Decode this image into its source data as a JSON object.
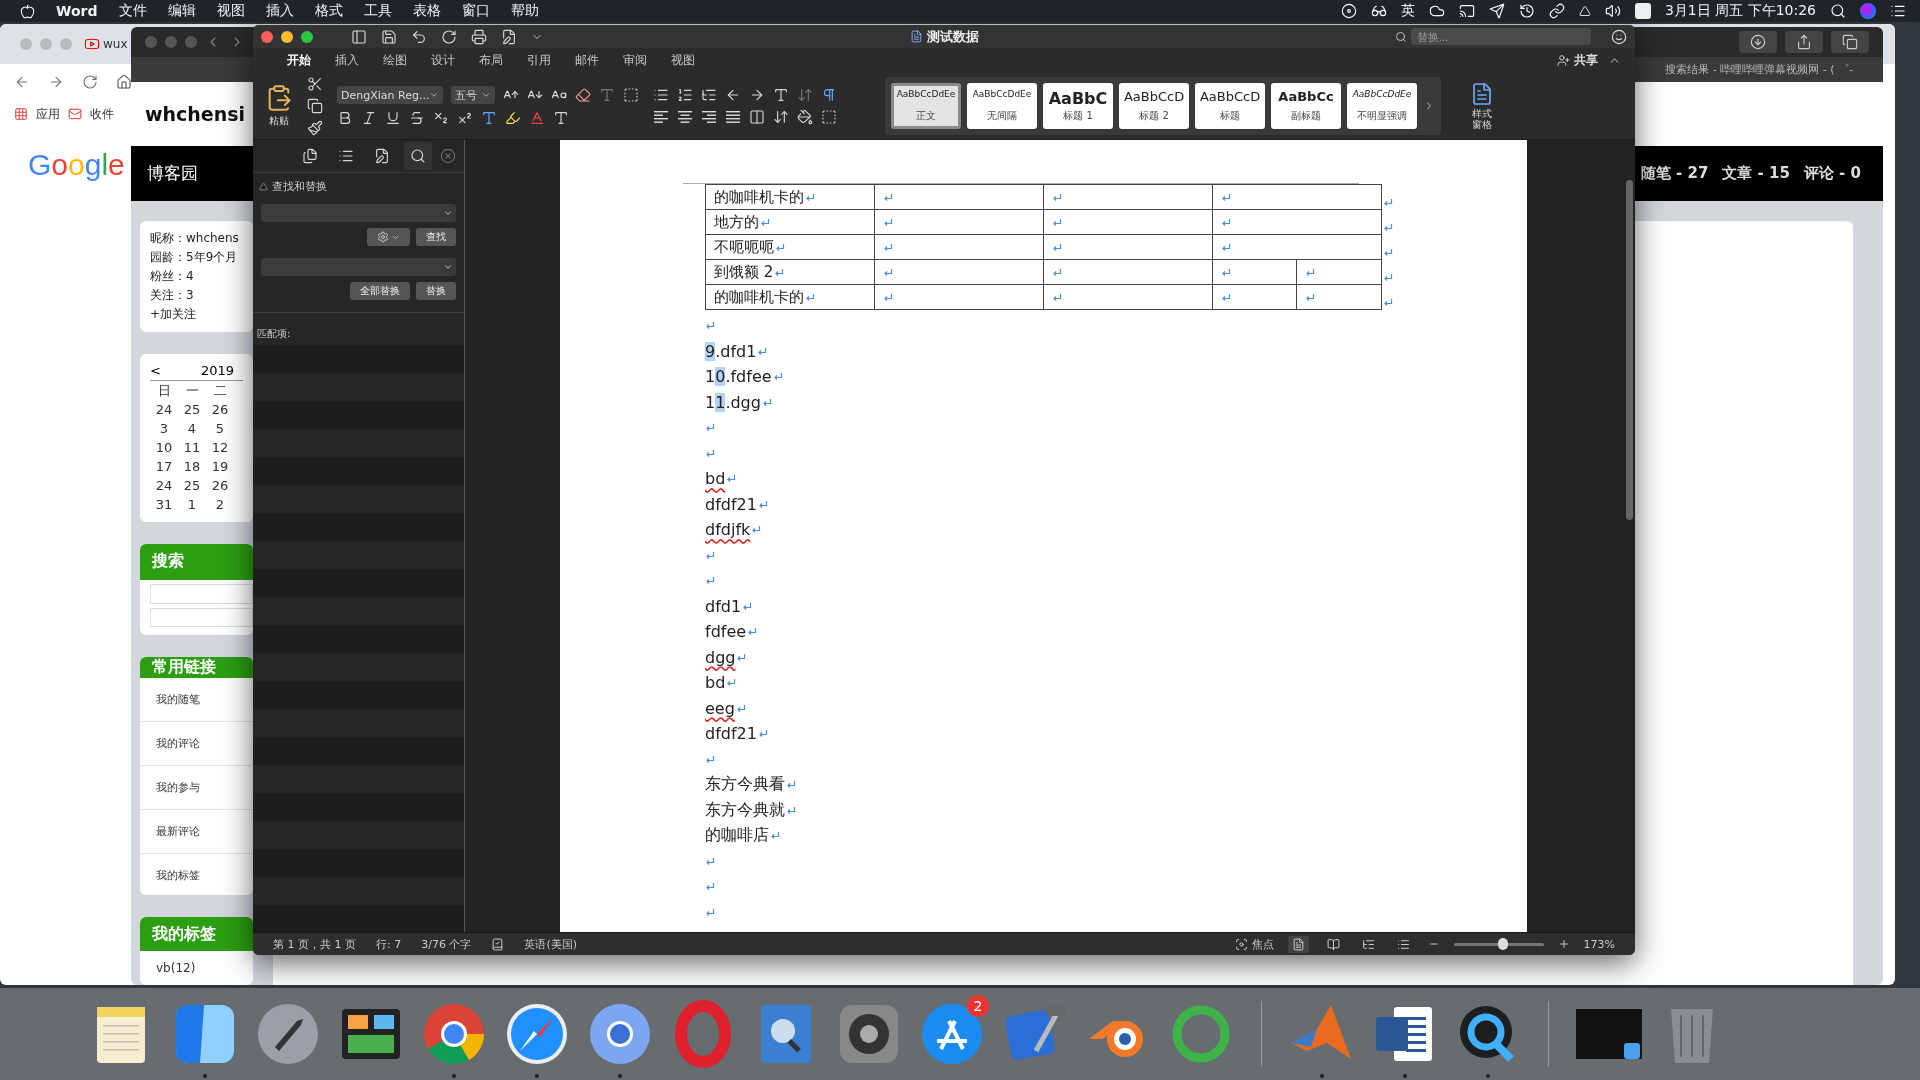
{
  "menubar": {
    "app": "Word",
    "menus": [
      "文件",
      "编辑",
      "视图",
      "插入",
      "格式",
      "工具",
      "表格",
      "窗口",
      "帮助"
    ],
    "input_source": "英",
    "clock": "3月1日 周五 下午10:26"
  },
  "chrome_window": {
    "tab_title": "wux",
    "bookmarks": [
      "应用",
      "收件"
    ],
    "logo": "Google"
  },
  "blog_window": {
    "tab_title": "搜索结果 - 哔哩哔哩弹幕视频网 - ( ゜-",
    "site_title": "whchensi",
    "nav_home": "博客园",
    "stats": [
      "随笔 - 27",
      "文章 - 15",
      "评论 - 0"
    ],
    "profile": [
      "昵称：whchens",
      "园龄：5年9个月",
      "粉丝：4",
      "关注：3",
      "+加关注"
    ],
    "calendar": {
      "prev": "<",
      "year": "2019",
      "weekdays": [
        "日",
        "一",
        "二"
      ],
      "weeks": [
        [
          "24",
          "25",
          "26"
        ],
        [
          "3",
          "4",
          "5"
        ],
        [
          "10",
          "11",
          "12"
        ],
        [
          "17",
          "18",
          "19"
        ],
        [
          "24",
          "25",
          "26"
        ],
        [
          "31",
          "1",
          "2"
        ]
      ]
    },
    "search_title": "搜索",
    "links_title": "常用链接",
    "links": [
      "我的随笔",
      "我的评论",
      "我的参与",
      "最新评论",
      "我的标签"
    ],
    "tags_title": "我的标签",
    "tags": [
      "vb(12)"
    ]
  },
  "word": {
    "title": "测试数据",
    "search_placeholder": "替换...",
    "ribbon_tabs": [
      {
        "label": "开始",
        "selected": true
      },
      {
        "label": "插入",
        "selected": false
      },
      {
        "label": "绘图",
        "selected": false
      },
      {
        "label": "设计",
        "selected": false
      },
      {
        "label": "布局",
        "selected": false
      },
      {
        "label": "引用",
        "selected": false
      },
      {
        "label": "邮件",
        "selected": false
      },
      {
        "label": "审阅",
        "selected": false
      },
      {
        "label": "视图",
        "selected": false
      }
    ],
    "share": "共享",
    "paste": "粘贴",
    "font_name": "DengXian Reg...",
    "font_size": "五号",
    "styles": [
      {
        "preview": "AaBbCcDdEe",
        "name": "正文",
        "kind": "normal",
        "selected": true
      },
      {
        "preview": "AaBbCcDdEe",
        "name": "无间隔",
        "kind": "normal",
        "selected": false
      },
      {
        "preview": "AaBbC",
        "name": "标题 1",
        "kind": "heading",
        "selected": false
      },
      {
        "preview": "AaBbCcD",
        "name": "标题 2",
        "kind": "subheading",
        "selected": false
      },
      {
        "preview": "AaBbCcD",
        "name": "标题",
        "kind": "title",
        "selected": false
      },
      {
        "preview": "AaBbCc",
        "name": "副标题",
        "kind": "strong",
        "selected": false
      },
      {
        "preview": "AaBbCcDdEe",
        "name": "不明显强调",
        "kind": "emphasis",
        "selected": false
      }
    ],
    "styles_pane": "样式窗格",
    "nav_pane": {
      "tabs": [
        {
          "kind": "thumbnails",
          "selected": false
        },
        {
          "kind": "outline",
          "selected": false
        },
        {
          "kind": "revisions",
          "selected": false
        },
        {
          "kind": "search",
          "selected": true
        }
      ],
      "section": "查找和替换",
      "find_button": "查找",
      "replace_all": "全部替换",
      "replace": "替换",
      "matches_label": "匹配项:"
    },
    "table": [
      {
        "label": "的咖啡机卡的",
        "split": false
      },
      {
        "label": "地方的",
        "split": false
      },
      {
        "label": "不呃呃呃",
        "split": false
      },
      {
        "label": "到饿额 2",
        "split": true
      },
      {
        "label": "的咖啡机卡的",
        "split": true
      }
    ],
    "paragraphs": [
      {
        "kind": "empty"
      },
      {
        "kind": "parts",
        "parts": [
          {
            "text": "9",
            "selected": true
          },
          {
            "text": ".dfd1",
            "selected": false
          }
        ]
      },
      {
        "kind": "parts",
        "parts": [
          {
            "text": "1",
            "selected": false
          },
          {
            "text": "0",
            "selected": true
          },
          {
            "text": ".fdfee",
            "selected": false
          }
        ]
      },
      {
        "kind": "parts",
        "parts": [
          {
            "text": "1",
            "selected": false
          },
          {
            "text": "1",
            "selected": true
          },
          {
            "text": ".dgg",
            "selected": false
          }
        ]
      },
      {
        "kind": "empty"
      },
      {
        "kind": "empty"
      },
      {
        "kind": "text",
        "text": "bd",
        "misspelled": true
      },
      {
        "kind": "text",
        "text": "dfdf21",
        "misspelled": false
      },
      {
        "kind": "text",
        "text": "dfdjfk",
        "misspelled": true
      },
      {
        "kind": "empty"
      },
      {
        "kind": "empty"
      },
      {
        "kind": "text",
        "text": "dfd1",
        "misspelled": false
      },
      {
        "kind": "text",
        "text": "fdfee",
        "misspelled": false
      },
      {
        "kind": "text",
        "text": "dgg",
        "misspelled": true
      },
      {
        "kind": "text",
        "text": "bd",
        "misspelled": false
      },
      {
        "kind": "text",
        "text": "eeg",
        "misspelled": true
      },
      {
        "kind": "text",
        "text": "dfdf21",
        "misspelled": false
      },
      {
        "kind": "empty"
      },
      {
        "kind": "text",
        "text": "东方今典看",
        "misspelled": false
      },
      {
        "kind": "text",
        "text": "东方今典就",
        "misspelled": false
      },
      {
        "kind": "text",
        "text": "的咖啡店",
        "misspelled": false
      },
      {
        "kind": "empty"
      },
      {
        "kind": "empty"
      },
      {
        "kind": "empty"
      }
    ],
    "status": {
      "page": "第 1 页，共 1 页",
      "line": "行: 7",
      "words": "3/76 个字",
      "language": "英语(美国)",
      "focus": "焦点",
      "zoom": "173%",
      "zoom_slider": {
        "level": 0.55
      }
    }
  },
  "dock": [
    {
      "kind": "notes",
      "running": false
    },
    {
      "kind": "finder",
      "running": true
    },
    {
      "kind": "launchpad",
      "running": false
    },
    {
      "kind": "panels",
      "running": false
    },
    {
      "kind": "chrome",
      "running": true
    },
    {
      "kind": "safari",
      "running": true
    },
    {
      "kind": "chromium",
      "running": true
    },
    {
      "kind": "opera",
      "running": false
    },
    {
      "kind": "dictionary",
      "running": false
    },
    {
      "kind": "prefs",
      "running": false
    },
    {
      "kind": "appstore",
      "running": false,
      "badge": "2"
    },
    {
      "kind": "xcode",
      "running": false
    },
    {
      "kind": "blender",
      "running": false
    },
    {
      "kind": "ring",
      "running": false
    },
    {
      "kind": "separator"
    },
    {
      "kind": "matlab",
      "running": true
    },
    {
      "kind": "word",
      "running": true
    },
    {
      "kind": "quicktime",
      "running": true
    },
    {
      "kind": "separator"
    },
    {
      "kind": "thumbnail",
      "running": false
    },
    {
      "kind": "trash",
      "running": false
    }
  ]
}
